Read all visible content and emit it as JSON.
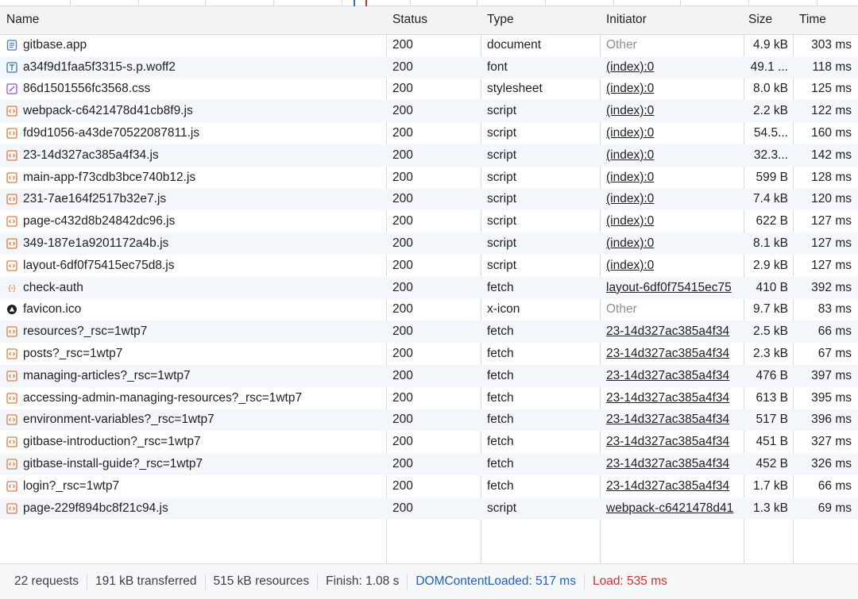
{
  "columns": {
    "name": "Name",
    "status": "Status",
    "type": "Type",
    "initiator": "Initiator",
    "size": "Size",
    "time": "Time"
  },
  "rows": [
    {
      "name": "gitbase.app",
      "icon": "document-icon",
      "status": "200",
      "type": "document",
      "initiator": "Other",
      "initiator_link": false,
      "size": "4.9 kB",
      "time": "303 ms"
    },
    {
      "name": "a34f9d1faa5f3315-s.p.woff2",
      "icon": "font-icon",
      "status": "200",
      "type": "font",
      "initiator": "(index):0",
      "initiator_link": true,
      "size": "49.1 ...",
      "time": "118 ms"
    },
    {
      "name": "86d1501556fc3568.css",
      "icon": "stylesheet-icon",
      "status": "200",
      "type": "stylesheet",
      "initiator": "(index):0",
      "initiator_link": true,
      "size": "8.0 kB",
      "time": "125 ms"
    },
    {
      "name": "webpack-c6421478d41cb8f9.js",
      "icon": "script-icon",
      "status": "200",
      "type": "script",
      "initiator": "(index):0",
      "initiator_link": true,
      "size": "2.2 kB",
      "time": "122 ms"
    },
    {
      "name": "fd9d1056-a43de70522087811.js",
      "icon": "script-icon",
      "status": "200",
      "type": "script",
      "initiator": "(index):0",
      "initiator_link": true,
      "size": "54.5...",
      "time": "160 ms"
    },
    {
      "name": "23-14d327ac385a4f34.js",
      "icon": "script-icon",
      "status": "200",
      "type": "script",
      "initiator": "(index):0",
      "initiator_link": true,
      "size": "32.3...",
      "time": "142 ms"
    },
    {
      "name": "main-app-f73cdb3bce740b12.js",
      "icon": "script-icon",
      "status": "200",
      "type": "script",
      "initiator": "(index):0",
      "initiator_link": true,
      "size": "599 B",
      "time": "128 ms"
    },
    {
      "name": "231-7ae164f2517b32e7.js",
      "icon": "script-icon",
      "status": "200",
      "type": "script",
      "initiator": "(index):0",
      "initiator_link": true,
      "size": "7.4 kB",
      "time": "120 ms"
    },
    {
      "name": "page-c432d8b24842dc96.js",
      "icon": "script-icon",
      "status": "200",
      "type": "script",
      "initiator": "(index):0",
      "initiator_link": true,
      "size": "622 B",
      "time": "127 ms"
    },
    {
      "name": "349-187e1a9201172a4b.js",
      "icon": "script-icon",
      "status": "200",
      "type": "script",
      "initiator": "(index):0",
      "initiator_link": true,
      "size": "8.1 kB",
      "time": "127 ms"
    },
    {
      "name": "layout-6df0f75415ec75d8.js",
      "icon": "script-icon",
      "status": "200",
      "type": "script",
      "initiator": "(index):0",
      "initiator_link": true,
      "size": "2.9 kB",
      "time": "127 ms"
    },
    {
      "name": "check-auth",
      "icon": "fetch-json-icon",
      "status": "200",
      "type": "fetch",
      "initiator": "layout-6df0f75415ec75",
      "initiator_link": true,
      "size": "410 B",
      "time": "392 ms"
    },
    {
      "name": "favicon.ico",
      "icon": "favicon-icon",
      "status": "200",
      "type": "x-icon",
      "initiator": "Other",
      "initiator_link": false,
      "size": "9.7 kB",
      "time": "83 ms"
    },
    {
      "name": "resources?_rsc=1wtp7",
      "icon": "script-icon",
      "status": "200",
      "type": "fetch",
      "initiator": "23-14d327ac385a4f34",
      "initiator_link": true,
      "size": "2.5 kB",
      "time": "66 ms"
    },
    {
      "name": "posts?_rsc=1wtp7",
      "icon": "script-icon",
      "status": "200",
      "type": "fetch",
      "initiator": "23-14d327ac385a4f34",
      "initiator_link": true,
      "size": "2.3 kB",
      "time": "67 ms"
    },
    {
      "name": "managing-articles?_rsc=1wtp7",
      "icon": "script-icon",
      "status": "200",
      "type": "fetch",
      "initiator": "23-14d327ac385a4f34",
      "initiator_link": true,
      "size": "476 B",
      "time": "397 ms"
    },
    {
      "name": "accessing-admin-managing-resources?_rsc=1wtp7",
      "icon": "script-icon",
      "status": "200",
      "type": "fetch",
      "initiator": "23-14d327ac385a4f34",
      "initiator_link": true,
      "size": "613 B",
      "time": "395 ms"
    },
    {
      "name": "environment-variables?_rsc=1wtp7",
      "icon": "script-icon",
      "status": "200",
      "type": "fetch",
      "initiator": "23-14d327ac385a4f34",
      "initiator_link": true,
      "size": "517 B",
      "time": "396 ms"
    },
    {
      "name": "gitbase-introduction?_rsc=1wtp7",
      "icon": "script-icon",
      "status": "200",
      "type": "fetch",
      "initiator": "23-14d327ac385a4f34",
      "initiator_link": true,
      "size": "451 B",
      "time": "327 ms"
    },
    {
      "name": "gitbase-install-guide?_rsc=1wtp7",
      "icon": "script-icon",
      "status": "200",
      "type": "fetch",
      "initiator": "23-14d327ac385a4f34",
      "initiator_link": true,
      "size": "452 B",
      "time": "326 ms"
    },
    {
      "name": "login?_rsc=1wtp7",
      "icon": "script-icon",
      "status": "200",
      "type": "fetch",
      "initiator": "23-14d327ac385a4f34",
      "initiator_link": true,
      "size": "1.7 kB",
      "time": "66 ms"
    },
    {
      "name": "page-229f894bc8f21c94.js",
      "icon": "script-icon",
      "status": "200",
      "type": "script",
      "initiator": "webpack-c6421478d41",
      "initiator_link": true,
      "size": "1.3 kB",
      "time": "69 ms"
    }
  ],
  "summary": {
    "requests": "22 requests",
    "transferred": "191 kB transferred",
    "resources": "515 kB resources",
    "finish": "Finish: 1.08 s",
    "dom_content_loaded": "DOMContentLoaded: 517 ms",
    "load": "Load: 535 ms"
  },
  "colors": {
    "document": "#4a74d8",
    "font": "#2f7fb8",
    "stylesheet": "#9b4dd6",
    "script": "#e07a3a",
    "fetch_json": "#e0902a",
    "favicon": "#1f1f1f",
    "dcl_blue": "#1d5fcc",
    "load_red": "#d93025"
  }
}
